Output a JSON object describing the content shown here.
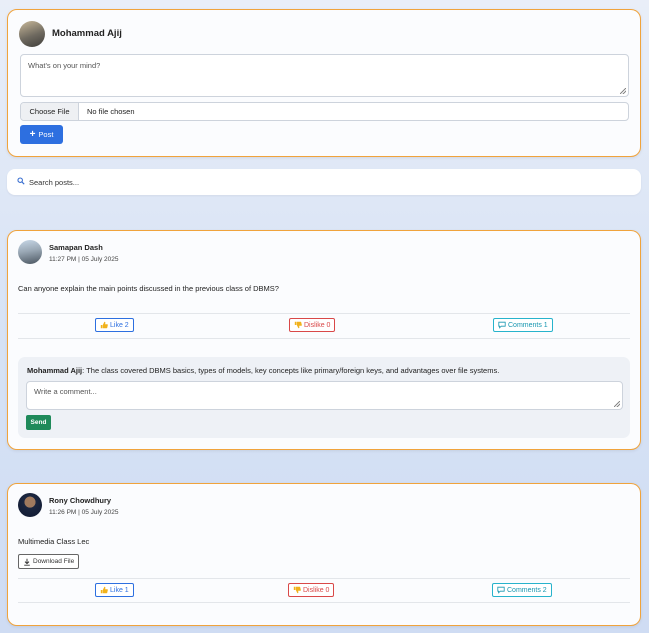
{
  "composer": {
    "user_name": "Mohammad Ajij",
    "textarea_placeholder": "What's on your mind?",
    "file_button": "Choose File",
    "file_status": "No file chosen",
    "post_label": "Post"
  },
  "search": {
    "placeholder": "Search posts..."
  },
  "posts": [
    {
      "author": "Samapan Dash",
      "time": "11:27 PM | 05 July 2025",
      "text": "Can anyone explain the main points discussed in the previous class of DBMS?",
      "like_label": "Like 2",
      "dislike_label": "Dislike 0",
      "comments_label": "Comments 1",
      "comments": [
        {
          "author": "Mohammad Ajij",
          "text": ": The class covered DBMS basics, types of models, key concepts like primary/foreign keys, and advantages over file systems."
        }
      ],
      "comment_placeholder": "Write a comment...",
      "send_label": "Send"
    },
    {
      "author": "Rony Chowdhury",
      "time": "11:26 PM | 05 July 2025",
      "text": "Multimedia Class Lec",
      "download_label": "Download File",
      "like_label": "Like 1",
      "dislike_label": "Dislike 0",
      "comments_label": "Comments 2"
    }
  ],
  "icons": {
    "post": "plus-icon",
    "search": "magnifier-icon",
    "like": "thumbs-up-icon",
    "dislike": "thumbs-down-icon",
    "comments": "speech-bubble-icon",
    "download": "download-arrow-icon"
  },
  "colors": {
    "card_border": "#f0a33c",
    "primary": "#2d6fe0",
    "danger": "#d94848",
    "info": "#27b3cc",
    "success": "#1f8a5a"
  }
}
